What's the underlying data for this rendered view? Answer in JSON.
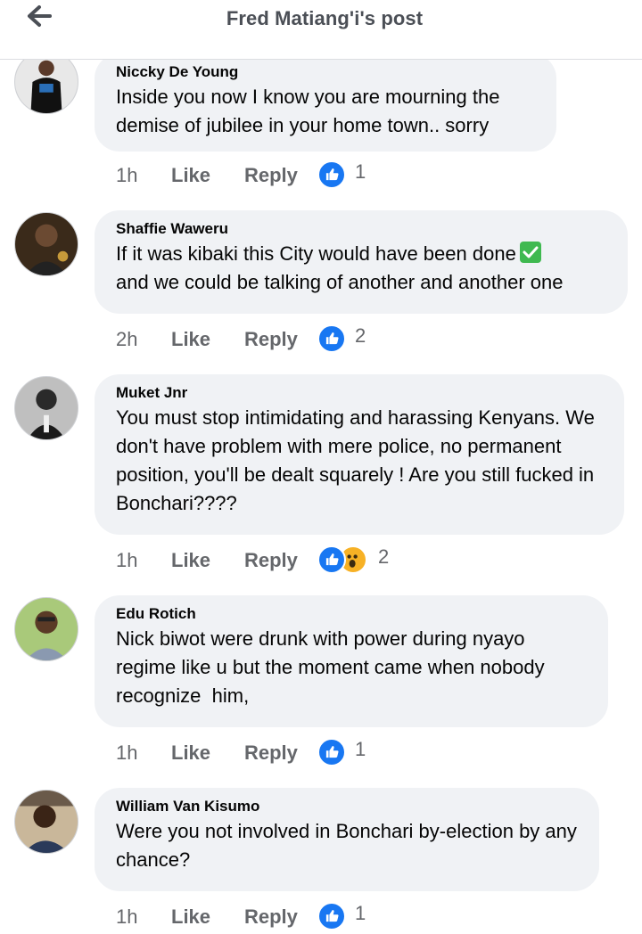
{
  "header": {
    "title": "Fred Matiang'i's post"
  },
  "comments": [
    {
      "author": "Niccky De Young",
      "text": "Inside you now I know you are mourning the demise of jubilee in your home town.. sorry",
      "time": "1h",
      "like_label": "Like",
      "reply_label": "Reply",
      "reaction_count": "1",
      "reactions": [
        "like-icon"
      ]
    },
    {
      "author": "Shaffie Waweru",
      "text": "If it was kibaki this City would have been done",
      "text_line2": "and we could be talking of another and another one",
      "emoji": "check-mark-emoji",
      "time": "2h",
      "like_label": "Like",
      "reply_label": "Reply",
      "reaction_count": "2",
      "reactions": [
        "like-icon"
      ]
    },
    {
      "author": "Muket Jnr",
      "text": "You must stop intimidating and harassing Kenyans. We don't have problem with mere police, no permanent position, you'll be dealt squarely ! Are you still fucked in Bonchari????",
      "time": "1h",
      "like_label": "Like",
      "reply_label": "Reply",
      "reaction_count": "2",
      "reactions": [
        "like-icon",
        "wow-icon"
      ]
    },
    {
      "author": "Edu Rotich",
      "text": "Nick biwot were drunk with power during nyayo regime like u but the moment came when nobody recognize  him,",
      "time": "1h",
      "like_label": "Like",
      "reply_label": "Reply",
      "reaction_count": "1",
      "reactions": [
        "like-icon"
      ]
    },
    {
      "author": "William Van Kisumo",
      "text": "Were you not involved in Bonchari by-election by any chance?",
      "time": "1h",
      "like_label": "Like",
      "reply_label": "Reply",
      "reaction_count": "1",
      "reactions": [
        "like-icon"
      ]
    }
  ],
  "colors": {
    "bubble": "#f0f2f5",
    "like_blue": "#1877f2",
    "meta_gray": "#65676b",
    "wow_yellow": "#f7b125"
  }
}
